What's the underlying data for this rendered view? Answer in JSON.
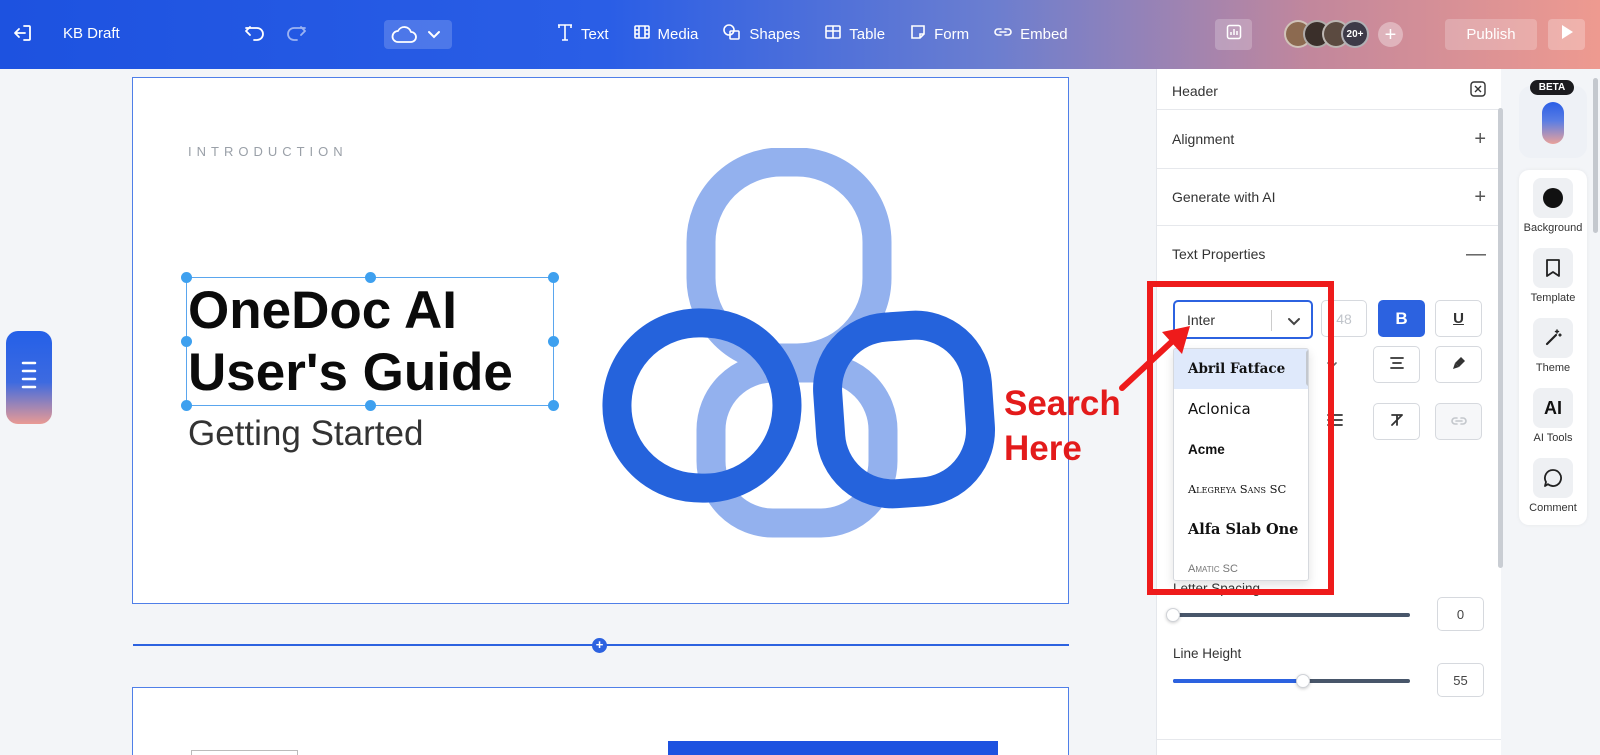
{
  "topbar": {
    "doc_title": "KB Draft",
    "tools": [
      {
        "label": "Text",
        "icon": "text-icon"
      },
      {
        "label": "Media",
        "icon": "media-icon"
      },
      {
        "label": "Shapes",
        "icon": "shapes-icon"
      },
      {
        "label": "Table",
        "icon": "table-icon"
      },
      {
        "label": "Form",
        "icon": "form-icon"
      },
      {
        "label": "Embed",
        "icon": "embed-icon"
      }
    ],
    "collaborator_count": "20+",
    "publish_label": "Publish"
  },
  "canvas": {
    "eyebrow": "INTRODUCTION",
    "headline_line1": "OneDoc AI",
    "headline_line2": "User's Guide",
    "subtitle": "Getting Started"
  },
  "panel": {
    "header_label": "Header",
    "sections": [
      {
        "label": "Alignment",
        "state": "collapsed"
      },
      {
        "label": "Generate with AI",
        "state": "collapsed"
      },
      {
        "label": "Text Properties",
        "state": "expanded"
      }
    ],
    "font_select": {
      "value": "Inter"
    },
    "font_size_placeholder": "48",
    "font_options": [
      "Abril Fatface",
      "Aclonica",
      "Acme",
      "Alegreya Sans SC",
      "Alfa Slab One",
      "Amatic SC"
    ],
    "letter_spacing": {
      "label": "Letter Spacing",
      "value": "0",
      "fraction": 0.0
    },
    "line_height": {
      "label": "Line Height",
      "value": "55",
      "fraction": 0.55
    }
  },
  "annotation": {
    "line1": "Search",
    "line2": "Here"
  },
  "rail": {
    "beta_label": "BETA",
    "items": [
      {
        "label": "Background",
        "icon": "background-icon"
      },
      {
        "label": "Template",
        "icon": "bookmark-icon"
      },
      {
        "label": "Theme",
        "icon": "magic-wand-icon"
      },
      {
        "label": "AI Tools",
        "icon": "ai-icon"
      },
      {
        "label": "Comment",
        "icon": "comment-icon"
      }
    ],
    "ai_glyph": "AI"
  },
  "colors": {
    "brand_blue": "#2c62e0",
    "annotation_red": "#ee1b1b"
  }
}
